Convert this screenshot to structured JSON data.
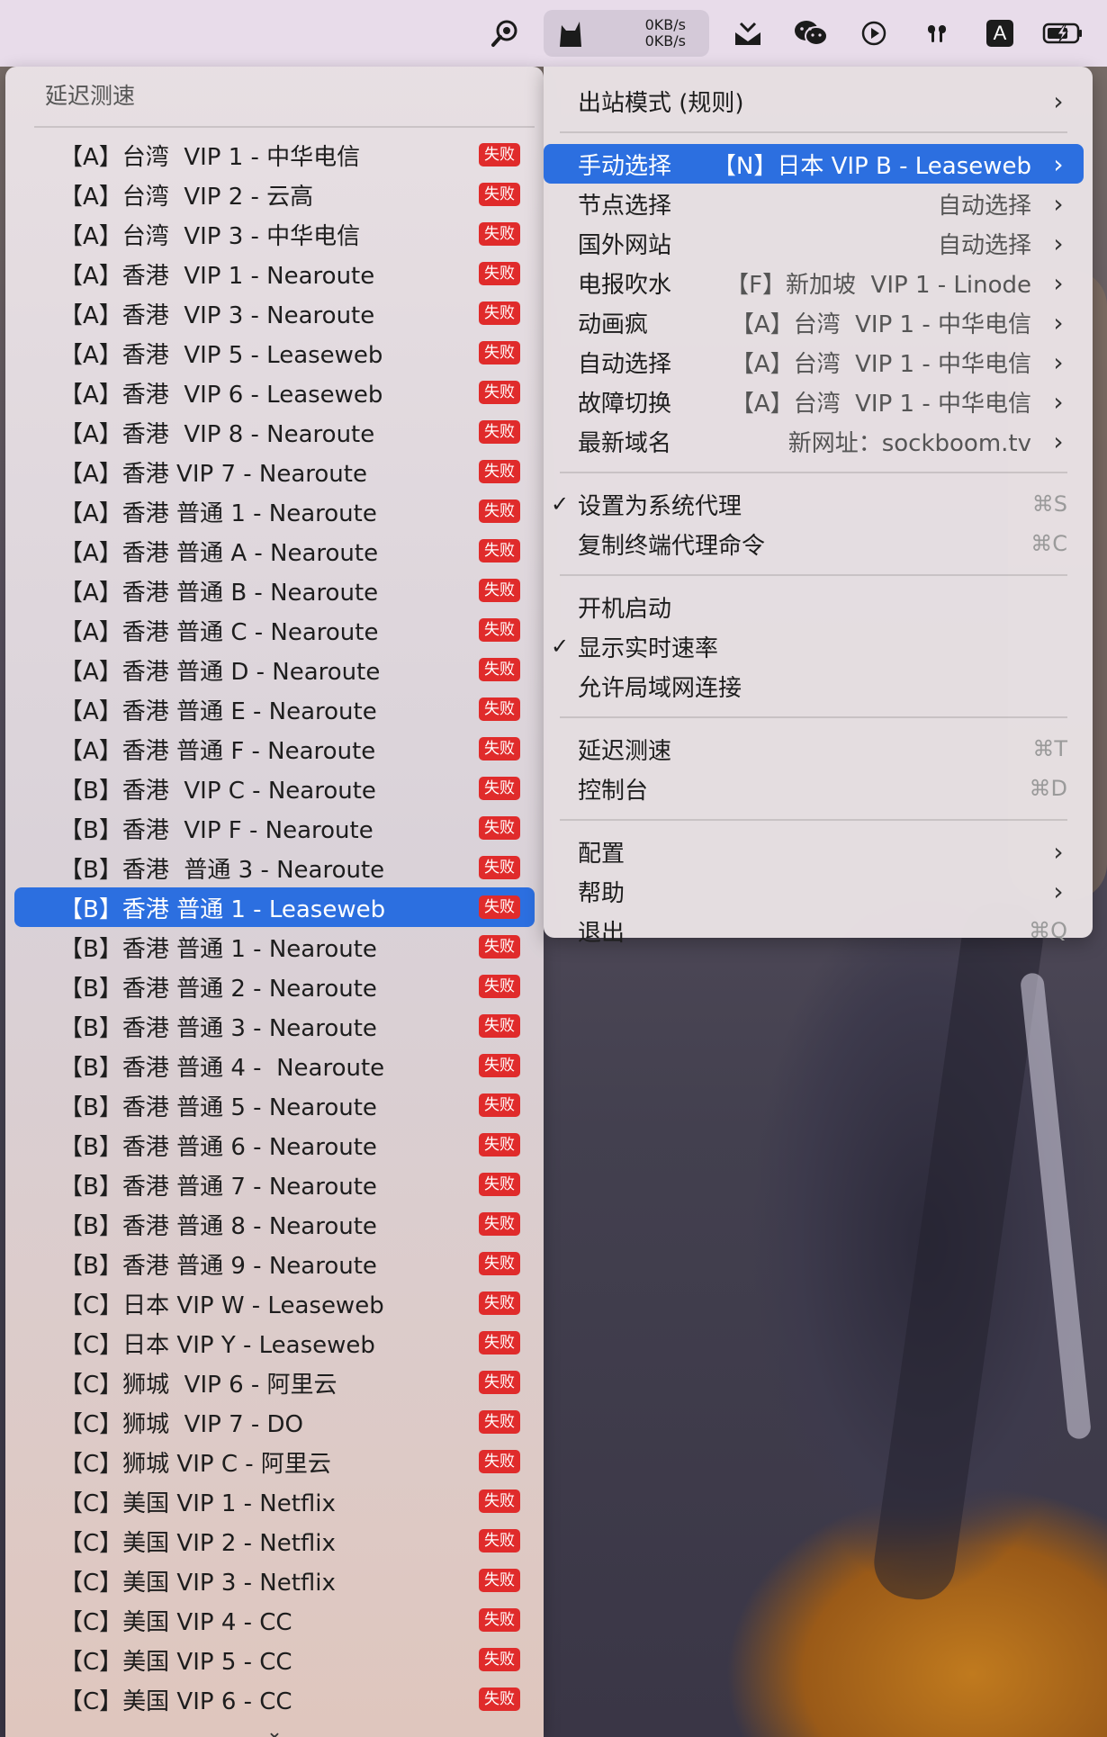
{
  "menubar": {
    "upload_speed": "0KB/s",
    "download_speed": "0KB/s",
    "input_source": "A"
  },
  "delay_test_menu": {
    "title": "延迟测速",
    "fail_label": "失败",
    "items": [
      "【A】台湾  VIP 1 - 中华电信",
      "【A】台湾  VIP 2 - 云高",
      "【A】台湾  VIP 3 - 中华电信",
      "【A】香港  VIP 1 - Nearoute",
      "【A】香港  VIP 3 - Nearoute",
      "【A】香港  VIP 5 - Leaseweb",
      "【A】香港  VIP 6 - Leaseweb",
      "【A】香港  VIP 8 - Nearoute",
      "【A】香港 VIP 7 - Nearoute",
      "【A】香港 普通 1 - Nearoute",
      "【A】香港 普通 A - Nearoute",
      "【A】香港 普通 B - Nearoute",
      "【A】香港 普通 C - Nearoute",
      "【A】香港 普通 D - Nearoute",
      "【A】香港 普通 E - Nearoute",
      "【A】香港 普通 F - Nearoute",
      "【B】香港  VIP C - Nearoute",
      "【B】香港  VIP F - Nearoute",
      "【B】香港  普通 3 - Nearoute",
      "【B】香港 普通 1 - Leaseweb",
      "【B】香港 普通 1 - Nearoute",
      "【B】香港 普通 2 - Nearoute",
      "【B】香港 普通 3 - Nearoute",
      "【B】香港 普通 4 -  Nearoute",
      "【B】香港 普通 5 - Nearoute",
      "【B】香港 普通 6 - Nearoute",
      "【B】香港 普通 7 - Nearoute",
      "【B】香港 普通 8 - Nearoute",
      "【B】香港 普通 9 - Nearoute",
      "【C】日本 VIP W - Leaseweb",
      "【C】日本 VIP Y - Leaseweb",
      "【C】狮城  VIP 6 - 阿里云",
      "【C】狮城  VIP 7 - DO",
      "【C】狮城 VIP C - 阿里云",
      "【C】美国 VIP 1 - Netflix",
      "【C】美国 VIP 2 - Netflix",
      "【C】美国 VIP 3 - Netflix",
      "【C】美国 VIP 4 - CC",
      "【C】美国 VIP 5 - CC",
      "【C】美国 VIP 6 - CC"
    ]
  },
  "main_menu": {
    "outbound_mode": "出站模式 (规则)",
    "groups": [
      {
        "label": "手动选择",
        "value": "【N】日本 VIP B - Leaseweb"
      },
      {
        "label": "节点选择",
        "value": "自动选择"
      },
      {
        "label": "国外网站",
        "value": "自动选择"
      },
      {
        "label": "电报吹水",
        "value": "【F】新加坡  VIP 1 - Linode"
      },
      {
        "label": "动画疯",
        "value": "【A】台湾  VIP 1 - 中华电信"
      },
      {
        "label": "自动选择",
        "value": "【A】台湾  VIP 1 - 中华电信"
      },
      {
        "label": "故障切换",
        "value": "【A】台湾  VIP 1 - 中华电信"
      },
      {
        "label": "最新域名",
        "value": "新网址：sockboom.tv"
      }
    ],
    "set_system_proxy": "设置为系统代理",
    "set_system_proxy_shortcut": "⌘S",
    "copy_terminal_cmd": "复制终端代理命令",
    "copy_terminal_cmd_shortcut": "⌘C",
    "launch_at_login": "开机启动",
    "show_speed": "显示实时速率",
    "allow_lan": "允许局域网连接",
    "delay_test": "延迟测速",
    "delay_test_shortcut": "⌘T",
    "console": "控制台",
    "console_shortcut": "⌘D",
    "config": "配置",
    "help": "帮助",
    "quit": "退出",
    "quit_shortcut": "⌘Q"
  }
}
